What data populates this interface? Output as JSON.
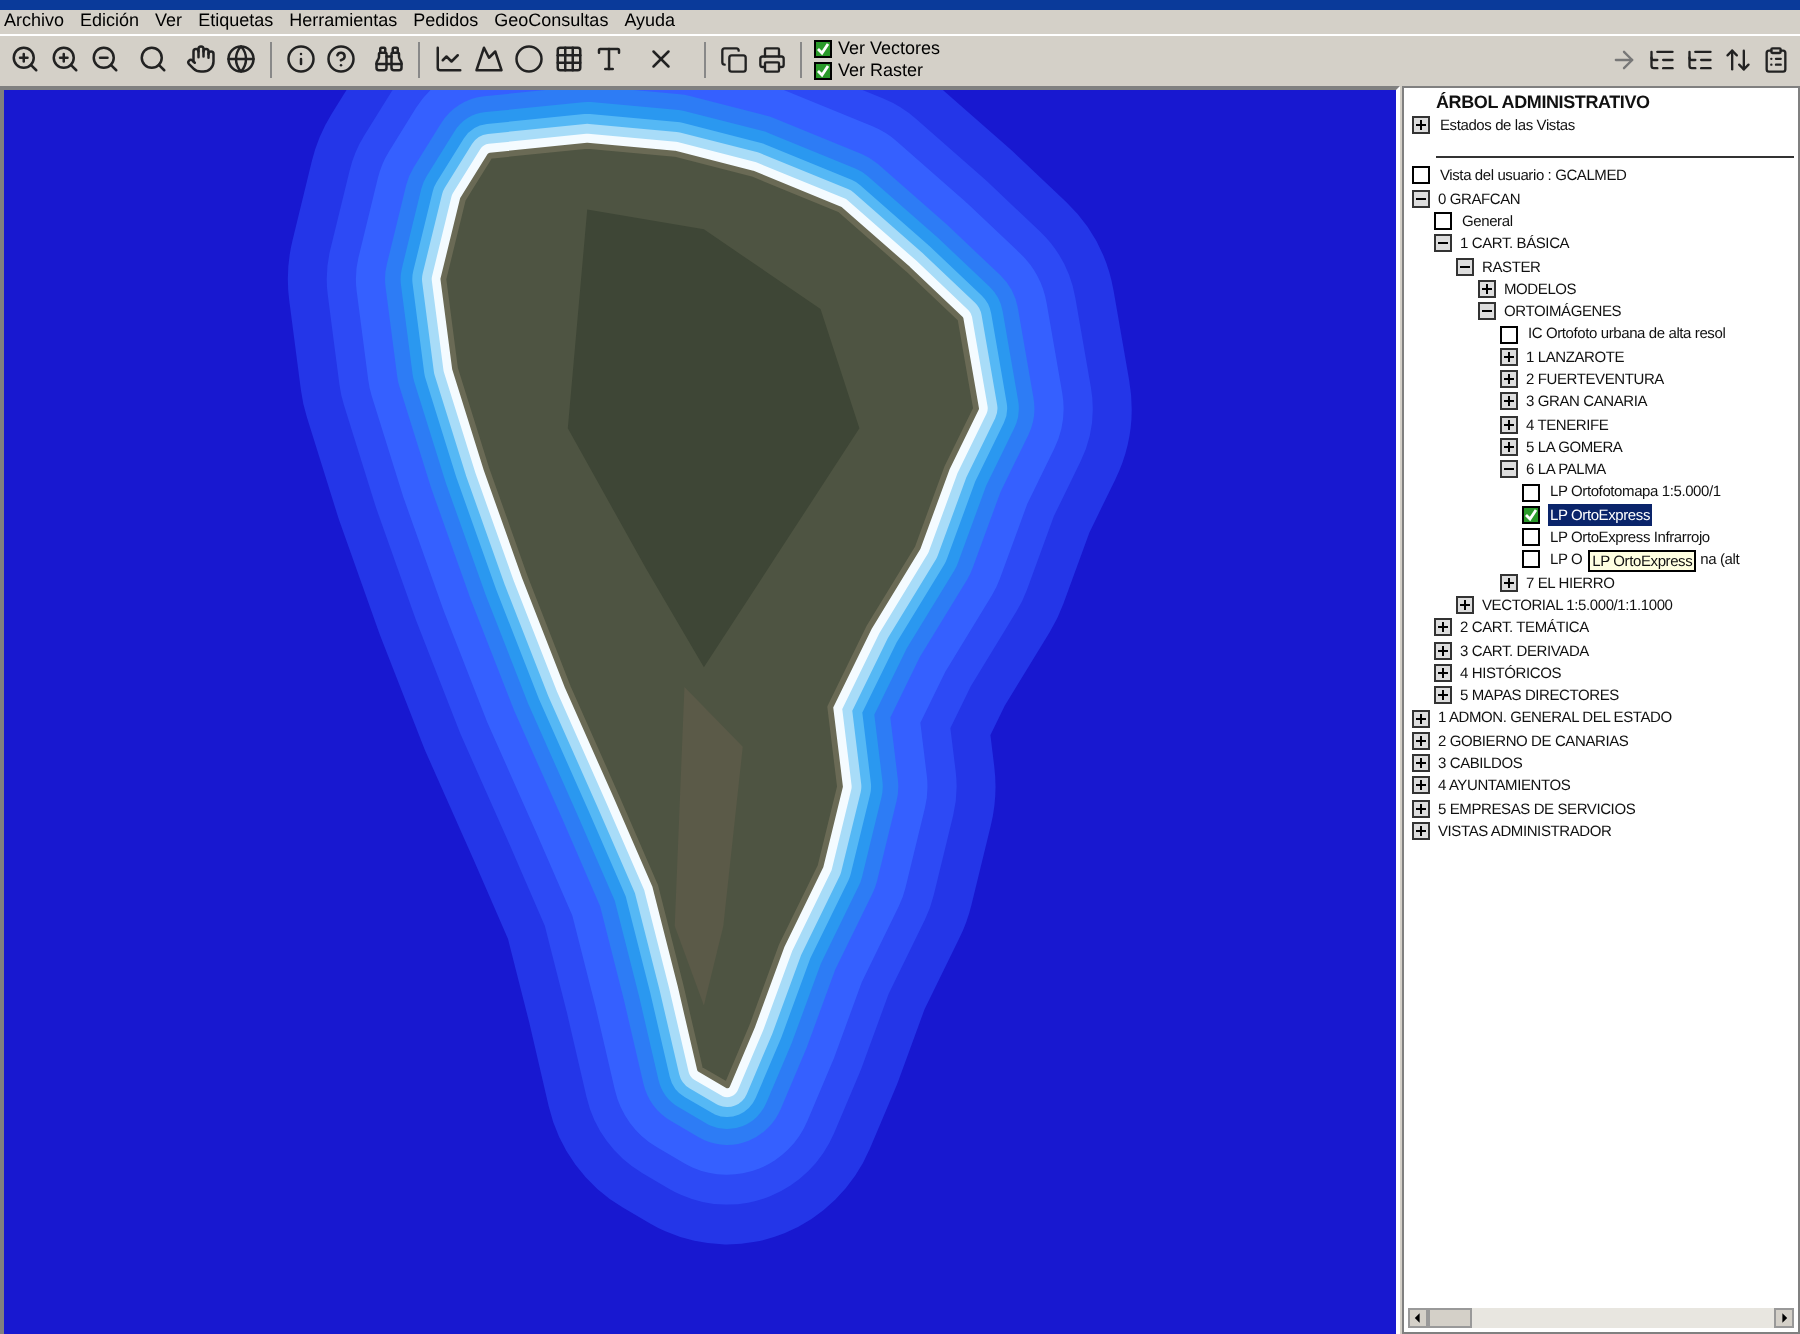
{
  "menu": [
    "Archivo",
    "Edición",
    "Ver",
    "Etiquetas",
    "Herramientas",
    "Pedidos",
    "GeoConsultas",
    "Ayuda"
  ],
  "layer_toggles": [
    {
      "label": "Ver Vectores",
      "checked": true
    },
    {
      "label": "Ver Raster",
      "checked": true
    }
  ],
  "panel": {
    "title": "ÁRBOL ADMINISTRATIVO",
    "views": {
      "label": "Estados de las Vistas",
      "expanded": false
    },
    "tree": [
      {
        "kind": "layer",
        "label": "Vista del usuario : GCALMED",
        "checked": false,
        "selected": false
      },
      {
        "kind": "group",
        "label": "0 GRAFCAN",
        "expanded": true,
        "children": [
          {
            "kind": "layer",
            "label": "General",
            "checked": false,
            "selected": false
          },
          {
            "kind": "group",
            "label": "1 CART. BÁSICA",
            "expanded": true,
            "children": [
              {
                "kind": "group",
                "label": "RASTER",
                "expanded": true,
                "children": [
                  {
                    "kind": "group",
                    "label": "MODELOS",
                    "expanded": false
                  },
                  {
                    "kind": "group",
                    "label": "ORTOIMÁGENES",
                    "expanded": true,
                    "children": [
                      {
                        "kind": "layer",
                        "label": "IC Ortofoto urbana de alta resol",
                        "checked": false,
                        "selected": false
                      },
                      {
                        "kind": "group",
                        "label": "1 LANZAROTE",
                        "expanded": false
                      },
                      {
                        "kind": "group",
                        "label": "2 FUERTEVENTURA",
                        "expanded": false
                      },
                      {
                        "kind": "group",
                        "label": "3 GRAN CANARIA",
                        "expanded": false
                      },
                      {
                        "kind": "group",
                        "label": "4 TENERIFE",
                        "expanded": false
                      },
                      {
                        "kind": "group",
                        "label": "5 LA GOMERA",
                        "expanded": false
                      },
                      {
                        "kind": "group",
                        "label": "6 LA PALMA",
                        "expanded": true,
                        "children": [
                          {
                            "kind": "layer",
                            "label": "LP Ortofotomapa 1:5.000/1",
                            "checked": false,
                            "selected": false
                          },
                          {
                            "kind": "layer",
                            "label": "LP OrtoExpress",
                            "checked": true,
                            "selected": true
                          },
                          {
                            "kind": "layer",
                            "label": "LP OrtoExpress Infrarrojo",
                            "checked": false,
                            "selected": false
                          },
                          {
                            "kind": "layer",
                            "label": "LP O",
                            "label_end": "na (alt",
                            "tooltip": "LP OrtoExpress",
                            "checked": false,
                            "selected": false
                          }
                        ]
                      },
                      {
                        "kind": "group",
                        "label": "7 EL HIERRO",
                        "expanded": false
                      }
                    ]
                  }
                ]
              },
              {
                "kind": "group",
                "label": "VECTORIAL 1:5.000/1:1.1000",
                "expanded": false
              }
            ]
          },
          {
            "kind": "group",
            "label": "2 CART. TEMÁTICA",
            "expanded": false
          },
          {
            "kind": "group",
            "label": "3 CART. DERIVADA",
            "expanded": false
          },
          {
            "kind": "group",
            "label": "4 HISTÓRICOS",
            "expanded": false
          },
          {
            "kind": "group",
            "label": "5 MAPAS DIRECTORES",
            "expanded": false
          }
        ]
      },
      {
        "kind": "group",
        "label": "1 ADMON. GENERAL DEL ESTADO",
        "expanded": false
      },
      {
        "kind": "group",
        "label": "2 GOBIERNO DE CANARIAS",
        "expanded": false
      },
      {
        "kind": "group",
        "label": "3 CABILDOS",
        "expanded": false
      },
      {
        "kind": "group",
        "label": "4 AYUNTAMIENTOS",
        "expanded": false
      },
      {
        "kind": "group",
        "label": "5 EMPRESAS DE SERVICIOS",
        "expanded": false
      },
      {
        "kind": "group",
        "label": "VISTAS ADMINISTRADOR",
        "expanded": false
      }
    ]
  }
}
